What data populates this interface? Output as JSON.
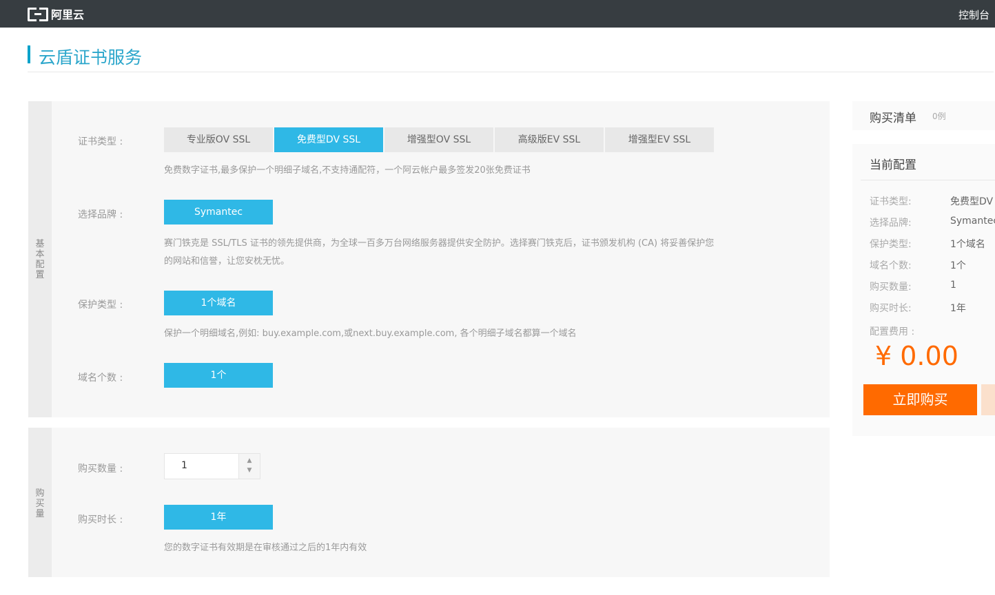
{
  "topbar": {
    "logo_text": "阿里云",
    "console_link": "控制台"
  },
  "page": {
    "title": "云盾证书服务"
  },
  "basic_config": {
    "section_label": "基本配置",
    "cert_type": {
      "label": "证书类型 :",
      "options": [
        "专业版OV SSL",
        "免费型DV SSL",
        "增强型OV SSL",
        "高级版EV SSL",
        "增强型EV SSL"
      ],
      "selected_index": 1,
      "description": "免费数字证书,最多保护一个明细子域名,不支持通配符，一个阿云帐户最多签发20张免费证书"
    },
    "brand": {
      "label": "选择品牌 :",
      "value": "Symantec",
      "description_line1": "赛门铁克是 SSL/TLS 证书的领先提供商，为全球一百多万台网络服务器提供安全防护。选择赛门铁克后，证书颁发机构 (CA) 将妥善保护您",
      "description_line2": "的网站和信誉，让您安枕无忧。"
    },
    "protect_type": {
      "label": "保护类型 :",
      "value": "1个域名",
      "description": "保护一个明细域名,例如: buy.example.com,或next.buy.example.com, 各个明细子域名都算一个域名"
    },
    "domain_count": {
      "label": "域名个数 :",
      "value": "1个"
    }
  },
  "purchase": {
    "section_label": "购买量",
    "quantity": {
      "label": "购买数量 :",
      "value": "1"
    },
    "duration": {
      "label": "购买时长 :",
      "value": "1年",
      "description": "您的数字证书有效期是在审核通过之后的1年内有效"
    }
  },
  "sidebar": {
    "cart_title": "购买清单",
    "cart_count": "0例",
    "config_title": "当前配置",
    "items": [
      {
        "label": "证书类型:",
        "value": "免费型DV SSL"
      },
      {
        "label": "选择品牌:",
        "value": "Symantec"
      },
      {
        "label": "保护类型:",
        "value": "1个域名"
      },
      {
        "label": "域名个数:",
        "value": "1个"
      },
      {
        "label": "购买数量:",
        "value": "1"
      },
      {
        "label": "购买时长:",
        "value": "1年"
      }
    ],
    "fee_label": "配置费用 :",
    "price": "¥ 0.00",
    "buy_button": "立即购买"
  },
  "colors": {
    "accent": "#2fb8e6",
    "topbar": "#373d41",
    "buy": "#ff6a00",
    "title": "#2ba6cb"
  }
}
